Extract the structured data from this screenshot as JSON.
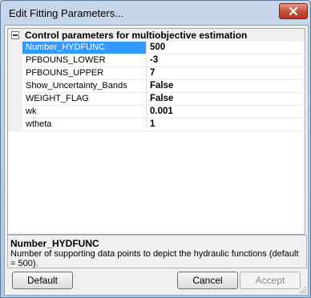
{
  "window": {
    "title": "Edit Fitting Parameters...",
    "close_icon": "close-icon",
    "accent_color": "#c54a35"
  },
  "grid": {
    "category_label": "Control parameters for multiobjective estimation",
    "properties": [
      {
        "name": "Number_HYDFUNC",
        "value": "500"
      },
      {
        "name": "PFBOUNS_LOWER",
        "value": "-3"
      },
      {
        "name": "PFBOUNS_UPPER",
        "value": "7"
      },
      {
        "name": "Show_Uncertainty_Bands",
        "value": "False"
      },
      {
        "name": "WEIGHT_FLAG",
        "value": "False"
      },
      {
        "name": "wk",
        "value": "0.001"
      },
      {
        "name": "wtheta",
        "value": "1"
      }
    ],
    "selected_color": "#3399ff"
  },
  "help": {
    "title": "Number_HYDFUNC",
    "description": "Number of supporting data points to depict the hydraulic functions (default = 500)."
  },
  "buttons": {
    "default_label": "Default",
    "cancel_label": "Cancel",
    "accept_label": "Accept"
  }
}
